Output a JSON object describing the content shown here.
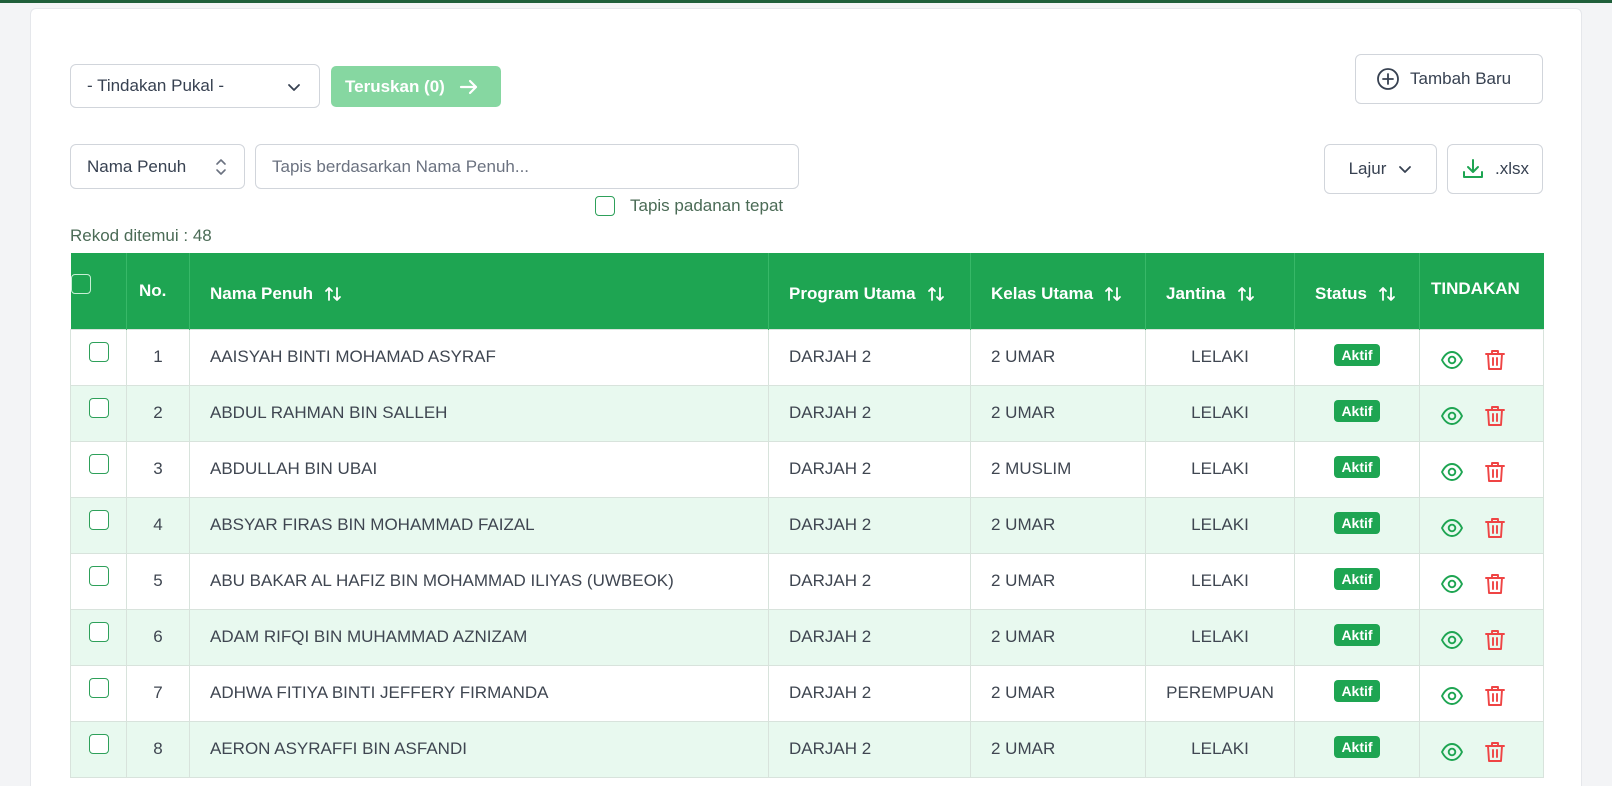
{
  "toolbar": {
    "bulk_action_label": "- Tindakan Pukal -",
    "forward_label": "Teruskan (0)",
    "add_new_label": "Tambah Baru"
  },
  "filter": {
    "field_label": "Nama Penuh",
    "search_placeholder": "Tapis berdasarkan Nama Penuh...",
    "exact_match_label": "Tapis padanan tepat",
    "columns_label": "Lajur",
    "export_label": ".xlsx",
    "record_count": "Rekod ditemui : 48"
  },
  "table": {
    "headers": {
      "no": "No.",
      "name": "Nama Penuh",
      "program": "Program Utama",
      "class": "Kelas Utama",
      "gender": "Jantina",
      "status": "Status",
      "actions": "TINDAKAN"
    },
    "rows": [
      {
        "no": "1",
        "name": "AAISYAH BINTI MOHAMAD ASYRAF",
        "program": "DARJAH 2",
        "class": "2 UMAR",
        "gender": "LELAKI",
        "status": "Aktif"
      },
      {
        "no": "2",
        "name": "ABDUL RAHMAN BIN SALLEH",
        "program": "DARJAH 2",
        "class": "2 UMAR",
        "gender": "LELAKI",
        "status": "Aktif"
      },
      {
        "no": "3",
        "name": "ABDULLAH BIN UBAI",
        "program": "DARJAH 2",
        "class": "2 MUSLIM",
        "gender": "LELAKI",
        "status": "Aktif"
      },
      {
        "no": "4",
        "name": "ABSYAR FIRAS BIN MOHAMMAD FAIZAL",
        "program": "DARJAH 2",
        "class": "2 UMAR",
        "gender": "LELAKI",
        "status": "Aktif"
      },
      {
        "no": "5",
        "name": "ABU BAKAR AL HAFIZ BIN MOHAMMAD ILIYAS (UWBEOK)",
        "program": "DARJAH 2",
        "class": "2 UMAR",
        "gender": "LELAKI",
        "status": "Aktif"
      },
      {
        "no": "6",
        "name": "ADAM RIFQI BIN MUHAMMAD AZNIZAM",
        "program": "DARJAH 2",
        "class": "2 UMAR",
        "gender": "LELAKI",
        "status": "Aktif"
      },
      {
        "no": "7",
        "name": "ADHWA FITIYA BINTI JEFFERY FIRMANDA",
        "program": "DARJAH 2",
        "class": "2 UMAR",
        "gender": "PEREMPUAN",
        "status": "Aktif"
      },
      {
        "no": "8",
        "name": "AERON ASYRAFFI BIN ASFANDI",
        "program": "DARJAH 2",
        "class": "2 UMAR",
        "gender": "LELAKI",
        "status": "Aktif"
      }
    ]
  },
  "icons": {
    "bulk_chevron": "chevron-down-icon",
    "forward_arrow": "arrow-right-icon",
    "add": "plus-circle-icon",
    "field_sort": "chevron-up-down-icon",
    "columns_chevron": "chevron-down-icon",
    "export": "download-icon",
    "sort": "sort-arrows-icon",
    "view": "eye-icon",
    "delete": "trash-icon"
  },
  "colors": {
    "brand_green": "#1ea552",
    "forward_disabled": "#86d7a1",
    "row_alt": "#e8f9ef",
    "delete_red": "#ef4444"
  }
}
